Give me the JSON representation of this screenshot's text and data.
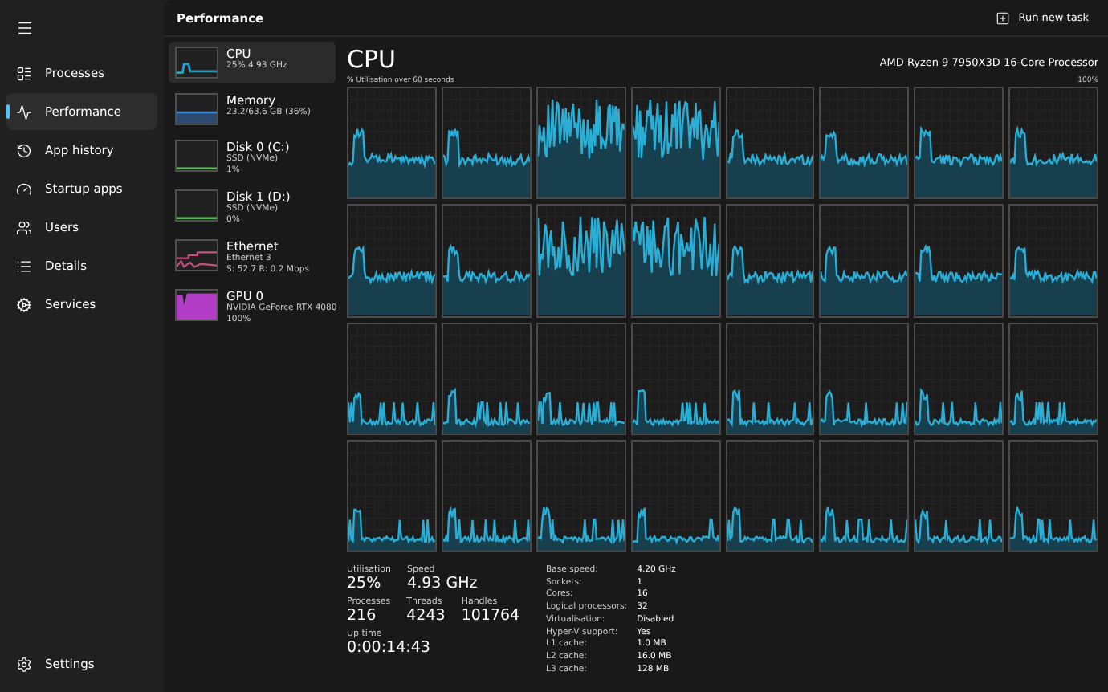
{
  "window": {
    "title": "Performance"
  },
  "toolbar": {
    "run_new_task": "Run new task"
  },
  "nav": {
    "items": [
      {
        "kind": "processes",
        "label": "Processes",
        "selected": false
      },
      {
        "kind": "performance",
        "label": "Performance",
        "selected": true
      },
      {
        "kind": "history",
        "label": "App history",
        "selected": false
      },
      {
        "kind": "startup",
        "label": "Startup apps",
        "selected": false
      },
      {
        "kind": "users",
        "label": "Users",
        "selected": false
      },
      {
        "kind": "details",
        "label": "Details",
        "selected": false
      },
      {
        "kind": "services",
        "label": "Services",
        "selected": false
      }
    ],
    "settings": "Settings"
  },
  "devices": [
    {
      "kind": "cpu",
      "name": "CPU",
      "lines": [
        "25% 4.93 GHz"
      ],
      "selected": true,
      "color": "#1fa3c9"
    },
    {
      "kind": "memory",
      "name": "Memory",
      "lines": [
        "23.2/63.6 GB (36%)"
      ],
      "selected": false,
      "color": "#3c7fd0"
    },
    {
      "kind": "disk",
      "name": "Disk 0 (C:)",
      "lines": [
        "SSD (NVMe)",
        "1%"
      ],
      "selected": false,
      "color": "#5fb05f"
    },
    {
      "kind": "disk",
      "name": "Disk 1 (D:)",
      "lines": [
        "SSD (NVMe)",
        "0%"
      ],
      "selected": false,
      "color": "#5fb05f"
    },
    {
      "kind": "network",
      "name": "Ethernet",
      "lines": [
        "Ethernet 3",
        "S: 52.7 R: 0.2 Mbps"
      ],
      "selected": false,
      "color": "#c8507e"
    },
    {
      "kind": "gpu",
      "name": "GPU 0",
      "lines": [
        "NVIDIA GeForce RTX 4080",
        "100%"
      ],
      "selected": false,
      "color": "#b23cc6"
    }
  ],
  "main": {
    "title": "CPU",
    "processor": "AMD Ryzen 9 7950X3D 16-Core Processor",
    "graph_caption": "% Utilisation over 60 seconds",
    "graph_max": "100%",
    "core_graphs": [
      {
        "kind": "active"
      },
      {
        "kind": "active"
      },
      {
        "kind": "busy"
      },
      {
        "kind": "busy"
      },
      {
        "kind": "active"
      },
      {
        "kind": "active"
      },
      {
        "kind": "active"
      },
      {
        "kind": "active"
      },
      {
        "kind": "active"
      },
      {
        "kind": "active"
      },
      {
        "kind": "busy"
      },
      {
        "kind": "busy"
      },
      {
        "kind": "active"
      },
      {
        "kind": "active"
      },
      {
        "kind": "active"
      },
      {
        "kind": "active"
      },
      {
        "kind": "idle"
      },
      {
        "kind": "idle"
      },
      {
        "kind": "idle"
      },
      {
        "kind": "idle"
      },
      {
        "kind": "idle"
      },
      {
        "kind": "idle"
      },
      {
        "kind": "idle"
      },
      {
        "kind": "idle"
      },
      {
        "kind": "idle"
      },
      {
        "kind": "idle"
      },
      {
        "kind": "idle"
      },
      {
        "kind": "idle"
      },
      {
        "kind": "idle"
      },
      {
        "kind": "idle"
      },
      {
        "kind": "idle"
      },
      {
        "kind": "idle"
      }
    ],
    "stat_rows": [
      [
        {
          "label": "Utilisation",
          "value": "25%"
        },
        {
          "label": "Speed",
          "value": "4.93 GHz"
        }
      ],
      [
        {
          "label": "Processes",
          "value": "216"
        },
        {
          "label": "Threads",
          "value": "4243"
        },
        {
          "label": "Handles",
          "value": "101764"
        }
      ],
      [
        {
          "label": "Up time",
          "value": "0:00:14:43"
        }
      ]
    ],
    "details": [
      {
        "label": "Base speed:",
        "value": "4.20 GHz"
      },
      {
        "label": "Sockets:",
        "value": "1"
      },
      {
        "label": "Cores:",
        "value": "16"
      },
      {
        "label": "Logical processors:",
        "value": "32"
      },
      {
        "label": "Virtualisation:",
        "value": "Disabled"
      },
      {
        "label": "Hyper-V support:",
        "value": "Yes"
      },
      {
        "label": "L1 cache:",
        "value": "1.0 MB"
      },
      {
        "label": "L2 cache:",
        "value": "16.0 MB"
      },
      {
        "label": "L3 cache:",
        "value": "128 MB"
      }
    ]
  }
}
